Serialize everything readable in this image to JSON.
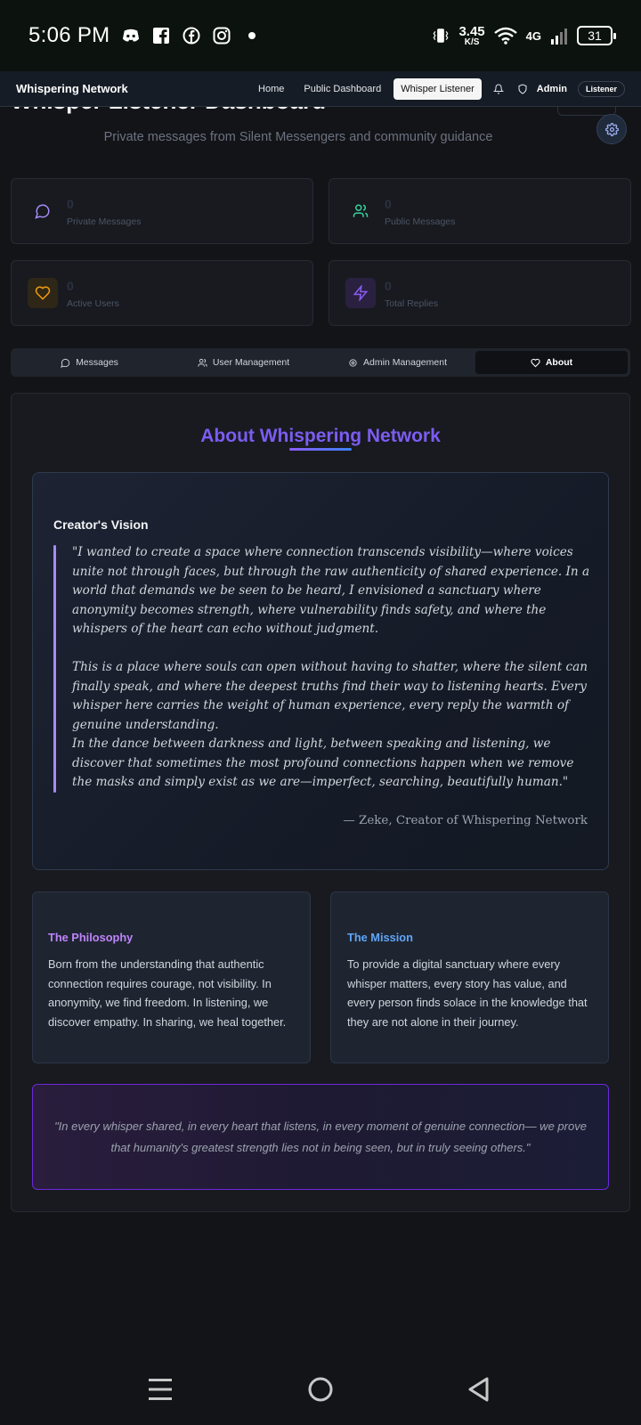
{
  "status_bar": {
    "time": "5:06 PM",
    "speed_value": "3.45",
    "speed_unit": "K/S",
    "network": "4G",
    "battery": "31",
    "icons": [
      "discord-icon",
      "facebook-square-icon",
      "facebook-icon",
      "instagram-icon",
      "dot-icon",
      "vibrate-icon",
      "wifi-icon",
      "signal-icon",
      "battery-icon"
    ]
  },
  "navbar": {
    "brand": "Whispering Network",
    "links": [
      "Home",
      "Public Dashboard",
      "Whisper Listener"
    ],
    "active_link": "Whisper Listener",
    "admin_label": "Admin",
    "role_badge": "Listener"
  },
  "header": {
    "title": "Whisper Listener Dashboard",
    "subtitle": "Private messages from Silent Messengers and community guidance"
  },
  "stats": [
    {
      "label": "Private Messages",
      "value": "0",
      "icon": "message-circle-icon",
      "color": "#a78bfa"
    },
    {
      "label": "Public Messages",
      "value": "0",
      "icon": "users-icon",
      "color": "#34d399"
    },
    {
      "label": "Active Users",
      "value": "0",
      "icon": "heart-icon",
      "color": "#f59e0b"
    },
    {
      "label": "Total Replies",
      "value": "0",
      "icon": "zap-icon",
      "color": "#8b5cf6"
    }
  ],
  "tabs": [
    {
      "label": "Messages",
      "icon": "message-circle-icon"
    },
    {
      "label": "User Management",
      "icon": "users-icon"
    },
    {
      "label": "Admin Management",
      "icon": "gear-icon"
    },
    {
      "label": "About",
      "icon": "heart-icon"
    }
  ],
  "active_tab": "About",
  "about": {
    "title": "About Whispering Network",
    "vision_heading": "Creator's Vision",
    "quote_paragraphs": [
      "\"I wanted to create a space where connection transcends visibility—where voices unite not through faces, but through the raw authenticity of shared experience. In a world that demands we be seen to be heard, I envisioned a sanctuary where anonymity becomes strength, where vulnerability finds safety, and where the whispers of the heart can echo without judgment.",
      "This is a place where souls can open without having to shatter, where the silent can finally speak, and where the deepest truths find their way to listening hearts. Every whisper here carries the weight of human experience, every reply the warmth of genuine understanding.",
      "In the dance between darkness and light, between speaking and listening, we discover that sometimes the most profound connections happen when we remove the masks and simply exist as we are—imperfect, searching, beautifully human.\""
    ],
    "attribution": "— Zeke, Creator of Whispering Network",
    "philosophy_heading": "The Philosophy",
    "philosophy_body": "Born from the understanding that authentic connection requires courage, not visibility. In anonymity, we find freedom. In listening, we discover empathy. In sharing, we heal together.",
    "mission_heading": "The Mission",
    "mission_body": "To provide a digital sanctuary where every whisper matters, every story has value, and every person finds solace in the knowledge that they are not alone in their journey.",
    "closing_quote": "\"In every whisper shared, in every heart that listens, in every moment of genuine connection— we prove that humanity's greatest strength lies not in being seen, but in truly seeing others.\""
  },
  "colors": {
    "accent_purple": "#7c5cf2",
    "philosophy_color": "#c084fc",
    "mission_color": "#60a5fa",
    "quote_bar": "#a78bfa"
  },
  "android_nav": [
    "menu-icon",
    "home-circle-icon",
    "back-triangle-icon"
  ]
}
